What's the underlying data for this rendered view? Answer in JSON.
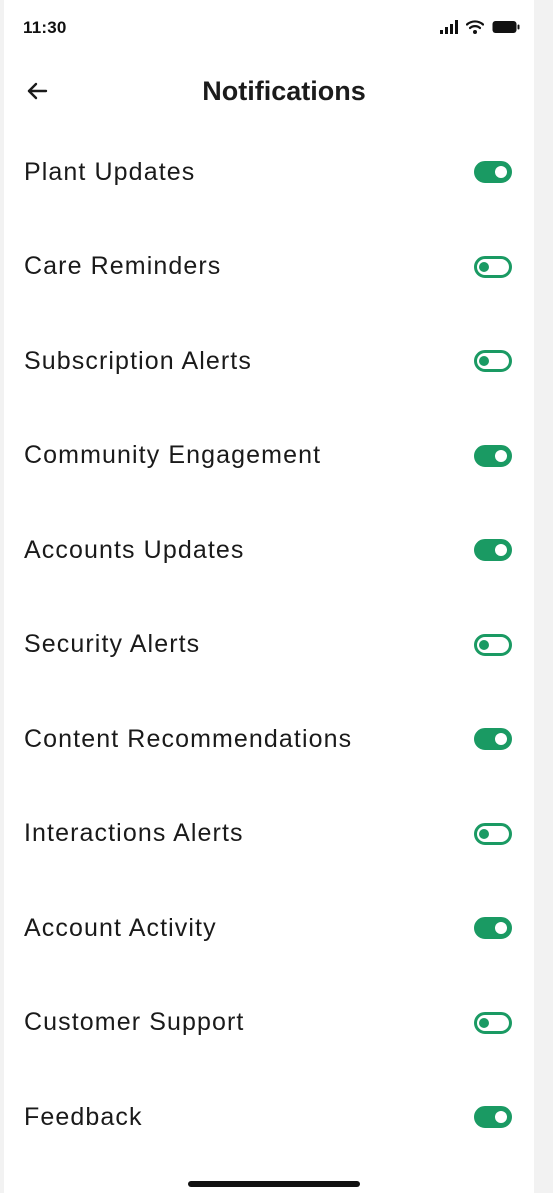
{
  "status_bar": {
    "time": "11:30"
  },
  "header": {
    "title": "Notifications"
  },
  "accent_color": "#1a9a63",
  "settings": [
    {
      "label": "Plant Updates",
      "enabled": true
    },
    {
      "label": "Care Reminders",
      "enabled": false
    },
    {
      "label": "Subscription Alerts",
      "enabled": false
    },
    {
      "label": "Community Engagement",
      "enabled": true
    },
    {
      "label": "Accounts Updates",
      "enabled": true
    },
    {
      "label": "Security Alerts",
      "enabled": false
    },
    {
      "label": "Content Recommendations",
      "enabled": true
    },
    {
      "label": "Interactions Alerts",
      "enabled": false
    },
    {
      "label": "Account Activity",
      "enabled": true
    },
    {
      "label": "Customer Support",
      "enabled": false
    },
    {
      "label": "Feedback",
      "enabled": true
    }
  ]
}
